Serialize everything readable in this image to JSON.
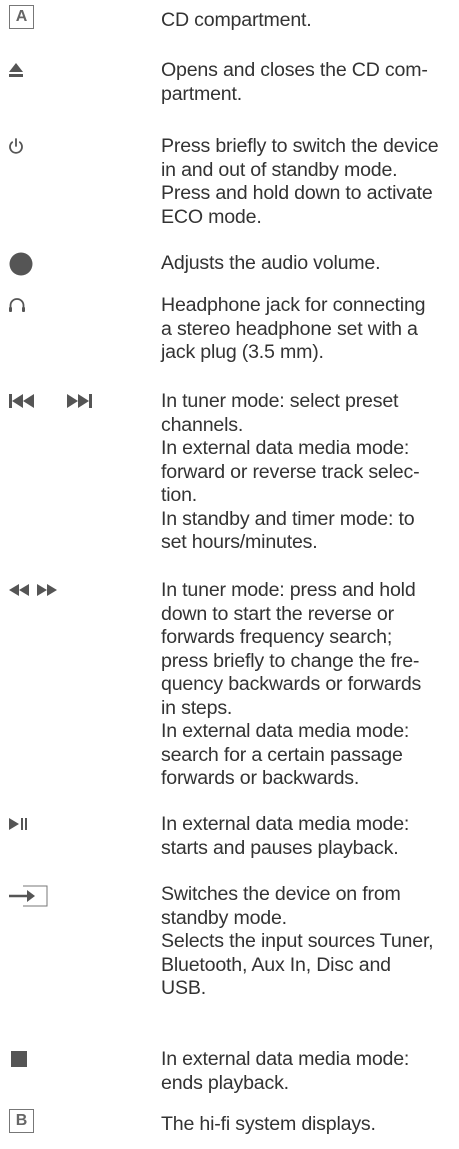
{
  "items": [
    {
      "icon": "boxed-letter-a-icon",
      "symbol": "A",
      "lines": [
        "CD compartment."
      ]
    },
    {
      "icon": "eject-icon",
      "lines": [
        "Opens and closes the CD com-",
        "partment."
      ]
    },
    {
      "icon": "power-standby-icon",
      "lines": [
        "Press briefly to switch the device",
        "in and out of standby mode.",
        "Press and hold down to activate",
        "ECO mode."
      ]
    },
    {
      "icon": "volume-knob-icon",
      "lines": [
        "Adjusts the audio volume."
      ]
    },
    {
      "icon": "headphones-icon",
      "lines": [
        "Headphone jack for connecting",
        "a stereo headphone set with a",
        "jack plug (3.5 mm)."
      ]
    },
    {
      "icon": "skip-previous-next-icon",
      "lines": [
        "In tuner mode: select preset",
        "channels.",
        "In external data media mode:",
        "forward or reverse track selec-",
        "tion.",
        "In standby and timer mode: to",
        "set hours/minutes."
      ]
    },
    {
      "icon": "rewind-fast-forward-icon",
      "lines": [
        "In tuner mode: press and hold",
        "down to start the reverse or",
        "forwards frequency search;",
        "press briefly to change the fre-",
        "quency backwards or forwards",
        "in steps.",
        "In external data media mode:",
        "search for a certain passage",
        "forwards or backwards."
      ]
    },
    {
      "icon": "play-pause-icon",
      "lines": [
        "In external data media mode:",
        "starts and pauses playback."
      ]
    },
    {
      "icon": "input-source-icon",
      "lines": [
        "Switches the device on from",
        "standby mode.",
        "Selects the input sources Tuner,",
        "Bluetooth, Aux In, Disc and",
        "USB."
      ]
    },
    {
      "icon": "stop-icon",
      "lines": [
        "In external data media mode:",
        "ends playback."
      ]
    },
    {
      "icon": "boxed-letter-b-icon",
      "symbol": "B",
      "lines": [
        "The hi-fi system displays."
      ]
    }
  ],
  "colors": {
    "text": "#333333",
    "icon": "#555555",
    "box_border": "#777777"
  }
}
